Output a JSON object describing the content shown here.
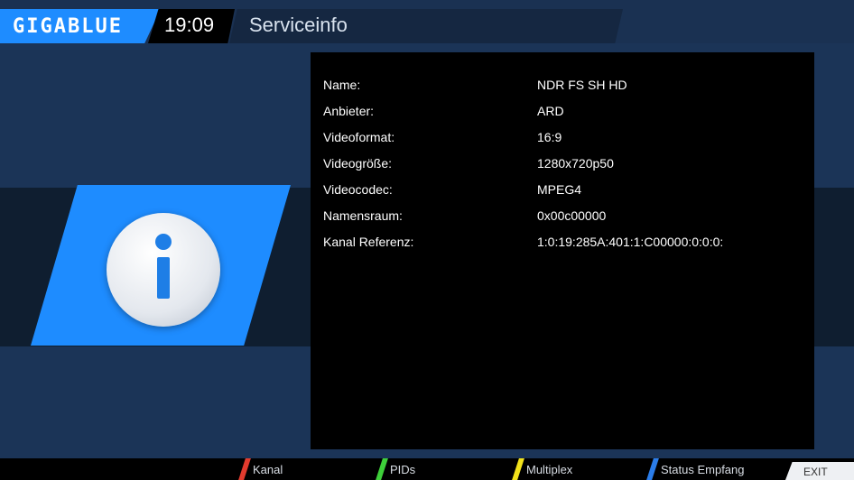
{
  "header": {
    "brand": "GIGABLUE",
    "time": "19:09",
    "title": "Serviceinfo"
  },
  "info_icon": "info-icon",
  "info_rows": [
    {
      "label": "Name:",
      "value": "NDR FS SH HD"
    },
    {
      "label": "Anbieter:",
      "value": "ARD"
    },
    {
      "label": "Videoformat:",
      "value": "16:9"
    },
    {
      "label": "Videogröße:",
      "value": "1280x720p50"
    },
    {
      "label": "Videocodec:",
      "value": "MPEG4"
    },
    {
      "label": "Namensraum:",
      "value": "0x00c00000"
    },
    {
      "label": "Kanal Referenz:",
      "value": "1:0:19:285A:401:1:C00000:0:0:0:"
    }
  ],
  "footer": {
    "buttons": [
      {
        "label": "Kanal",
        "color": "#e23b2e"
      },
      {
        "label": "PIDs",
        "color": "#3ecf3a"
      },
      {
        "label": "Multiplex",
        "color": "#f2e21a"
      },
      {
        "label": "Status Empfang",
        "color": "#2b7de9"
      }
    ],
    "exit_label": "EXIT"
  },
  "colors": {
    "accent": "#1e8cff",
    "background": "#182c44",
    "panel": "#000000"
  }
}
